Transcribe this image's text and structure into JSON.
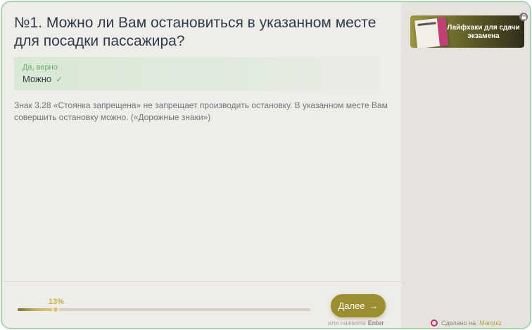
{
  "question": {
    "title": "№1. Можно ли Вам остановиться в указанном месте для посадки пассажира?"
  },
  "answer": {
    "status": "Да, верно",
    "text": "Можно",
    "icon": "check-icon"
  },
  "explanation": "Знак 3.28 «Стоянка запрещена» не запрещает производить остановку. В указанном месте Вам совершить остановку можно. («Дорожные знаки»)",
  "progress": {
    "percent_label": "13%",
    "value": 0.13
  },
  "next_button": {
    "label": "Далее",
    "icon": "arrow-right-icon"
  },
  "enter_hint": {
    "prefix": "или нажмите",
    "key": "Enter"
  },
  "sidebar": {
    "promo": {
      "title": "Лайфхаки для сдачи экзамена",
      "icon": "lock-icon"
    },
    "credit": {
      "prefix": "Сделано на",
      "brand": "Marquiz"
    }
  },
  "colors": {
    "accent": "#9b8e30",
    "success": "#6aaa6e",
    "frame_border": "#a9d3b3"
  }
}
